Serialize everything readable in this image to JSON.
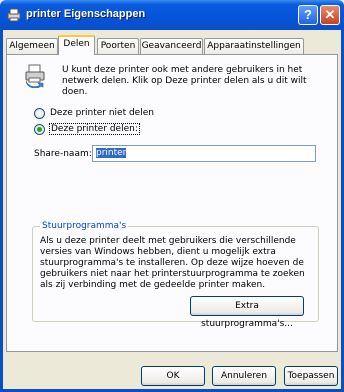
{
  "window": {
    "title": "printer Eigenschappen",
    "help_glyph": "?",
    "close_glyph": "✕"
  },
  "tabs": [
    {
      "label": "Algemeen",
      "active": false
    },
    {
      "label": "Delen",
      "active": true
    },
    {
      "label": "Poorten",
      "active": false
    },
    {
      "label": "Geavanceerd",
      "active": false
    },
    {
      "label": "Apparaatinstellingen",
      "active": false
    }
  ],
  "sharing": {
    "intro": "U kunt deze printer ook met andere gebruikers in het netwerk delen. Klik op Deze printer delen als u dit wilt doen.",
    "option_no_share": "Deze printer niet delen",
    "option_share": "Deze printer delen:",
    "selected_option": "share",
    "share_name_label": "Share-naam:",
    "share_name_value": "printer"
  },
  "drivers": {
    "legend": "Stuurprogramma's",
    "text": "Als u deze printer deelt met gebruikers die verschillende versies van Windows hebben, dient u mogelijk extra stuurprogramma's te installeren. Op deze wijze hoeven de gebruikers niet naar het printerstuurprogramma te zoeken als zij verbinding met de gedeelde printer maken.",
    "extra_button": "Extra stuurprogramma's..."
  },
  "footer": {
    "ok": "OK",
    "cancel": "Annuleren",
    "apply": "Toepassen"
  },
  "colors": {
    "titlebar": "#0553d8",
    "active_tab_accent": "#ffc83c",
    "selection": "#316ac5"
  }
}
